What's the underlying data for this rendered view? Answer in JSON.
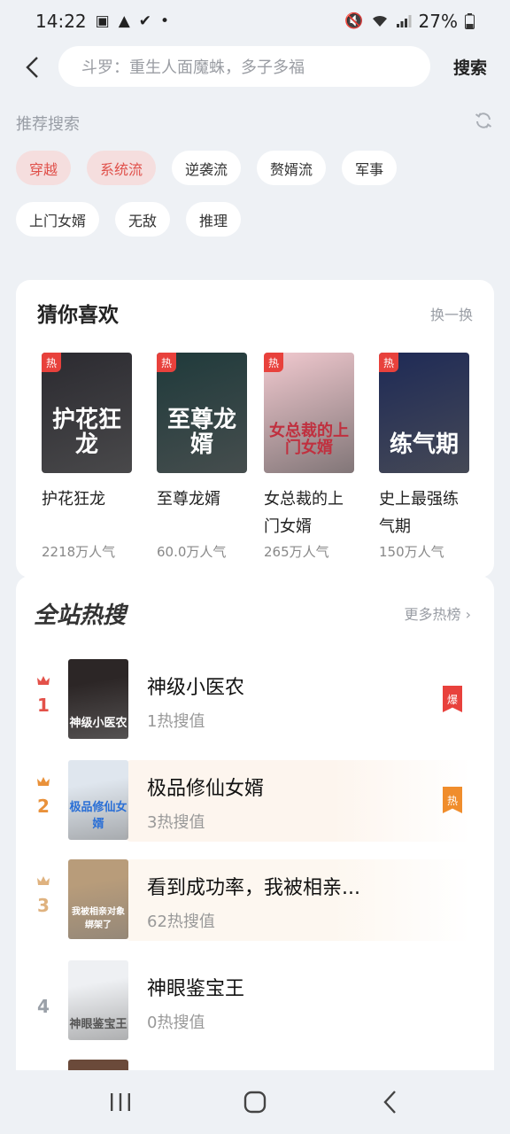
{
  "status_bar": {
    "time": "14:22",
    "battery": "27%"
  },
  "search": {
    "placeholder": "斗罗：重生人面魔蛛，多子多福",
    "button": "搜索"
  },
  "recommend": {
    "title": "推荐搜索",
    "tags": [
      {
        "label": "穿越",
        "hot": true
      },
      {
        "label": "系统流",
        "hot": true
      },
      {
        "label": "逆袭流",
        "hot": false
      },
      {
        "label": "赘婿流",
        "hot": false
      },
      {
        "label": "军事",
        "hot": false
      },
      {
        "label": "上门女婿",
        "hot": false
      },
      {
        "label": "无敌",
        "hot": false
      },
      {
        "label": "推理",
        "hot": false
      }
    ]
  },
  "guess": {
    "title": "猜你喜欢",
    "refresh": "换一换",
    "badge": "热",
    "books": [
      {
        "title": "护花狂龙",
        "popularity": "2218万人气",
        "cover_text": "护花狂龙",
        "cover_color": "#2b2a30"
      },
      {
        "title": "至尊龙婿",
        "popularity": "60.0万人气",
        "cover_text": "至尊龙婿",
        "cover_color": "#1f3a3b"
      },
      {
        "title": "女总裁的上门女婿",
        "popularity": "265万人气",
        "cover_text": "女总裁的上门女婿",
        "cover_color": "#f1c9cf"
      },
      {
        "title": "史上最强练气期",
        "popularity": "150万人气",
        "cover_text": "练气期",
        "cover_color": "#1e2a56"
      }
    ]
  },
  "hot_search": {
    "title": "全站热搜",
    "more": "更多热榜",
    "items": [
      {
        "rank": "1",
        "name": "神级小医农",
        "value": "1热搜值",
        "badge": "爆",
        "badge_color": "#e8413c",
        "rank_color": "#e35149",
        "bg": "#ffffff",
        "cover_color": "#2c2626",
        "cover_text": "神级小医农"
      },
      {
        "rank": "2",
        "name": "极品修仙女婿",
        "value": "3热搜值",
        "badge": "热",
        "badge_color": "#f08d2c",
        "rank_color": "#e9913a",
        "bg": "#fdf5ee",
        "cover_color": "#dfe6ee",
        "cover_text": "极品修仙女婿"
      },
      {
        "rank": "3",
        "name": "看到成功率，我被相亲...",
        "value": "62热搜值",
        "badge": "",
        "badge_color": "#ffffff",
        "rank_color": "#dfb27f",
        "bg": "#fdf7f0",
        "cover_color": "#b89c7a",
        "cover_text": "我被相亲对象绑架了"
      },
      {
        "rank": "4",
        "name": "神眼鉴宝王",
        "value": "0热搜值",
        "badge": "",
        "badge_color": "#ffffff",
        "rank_color": "#9aa0a8",
        "bg": "#ffffff",
        "cover_color": "#eef0f3",
        "cover_text": "神眼鉴宝王"
      }
    ]
  }
}
